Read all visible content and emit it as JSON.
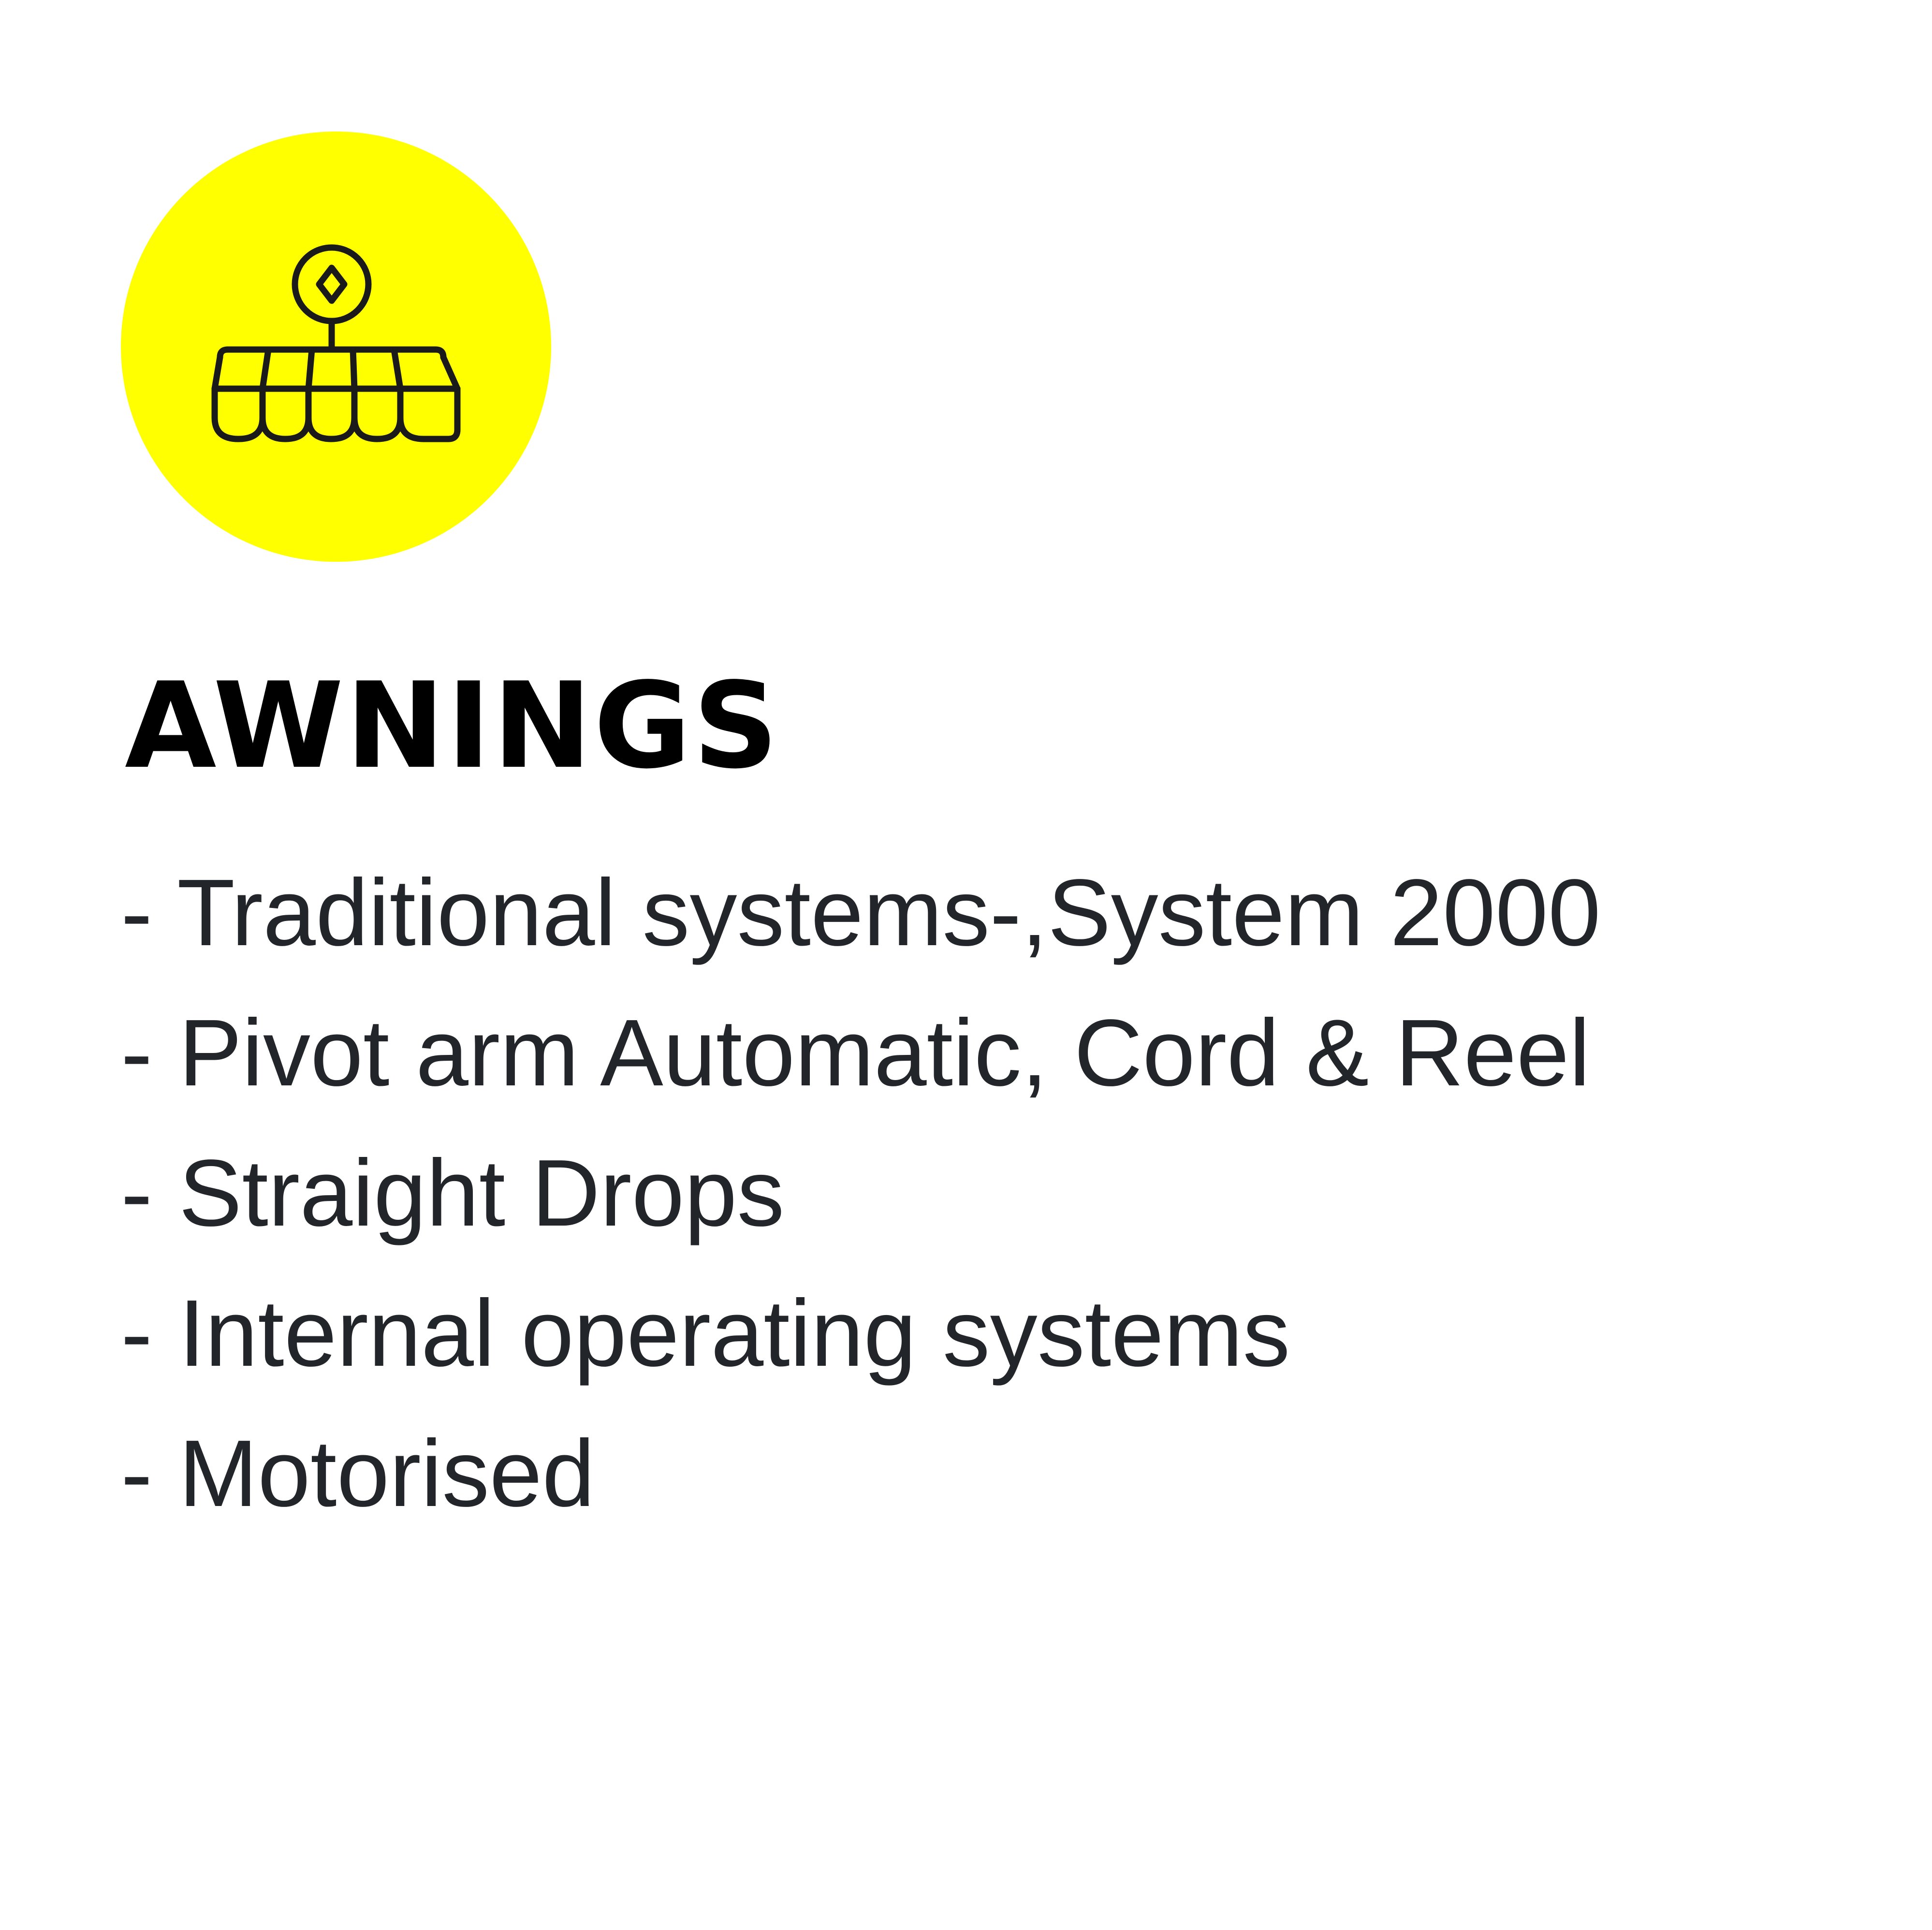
{
  "colors": {
    "badge_fill": "#ffff00",
    "icon_stroke": "#1a1a1a",
    "title": "#000000",
    "body_text": "#22252a"
  },
  "icon": "awning-icon",
  "title": "AWNINGS",
  "features": [
    "- Traditional systems-,System 2000",
    "- Pivot arm Automatic, Cord & Reel",
    "- Straight Drops",
    "- Internal operating systems",
    "- Motorised"
  ]
}
